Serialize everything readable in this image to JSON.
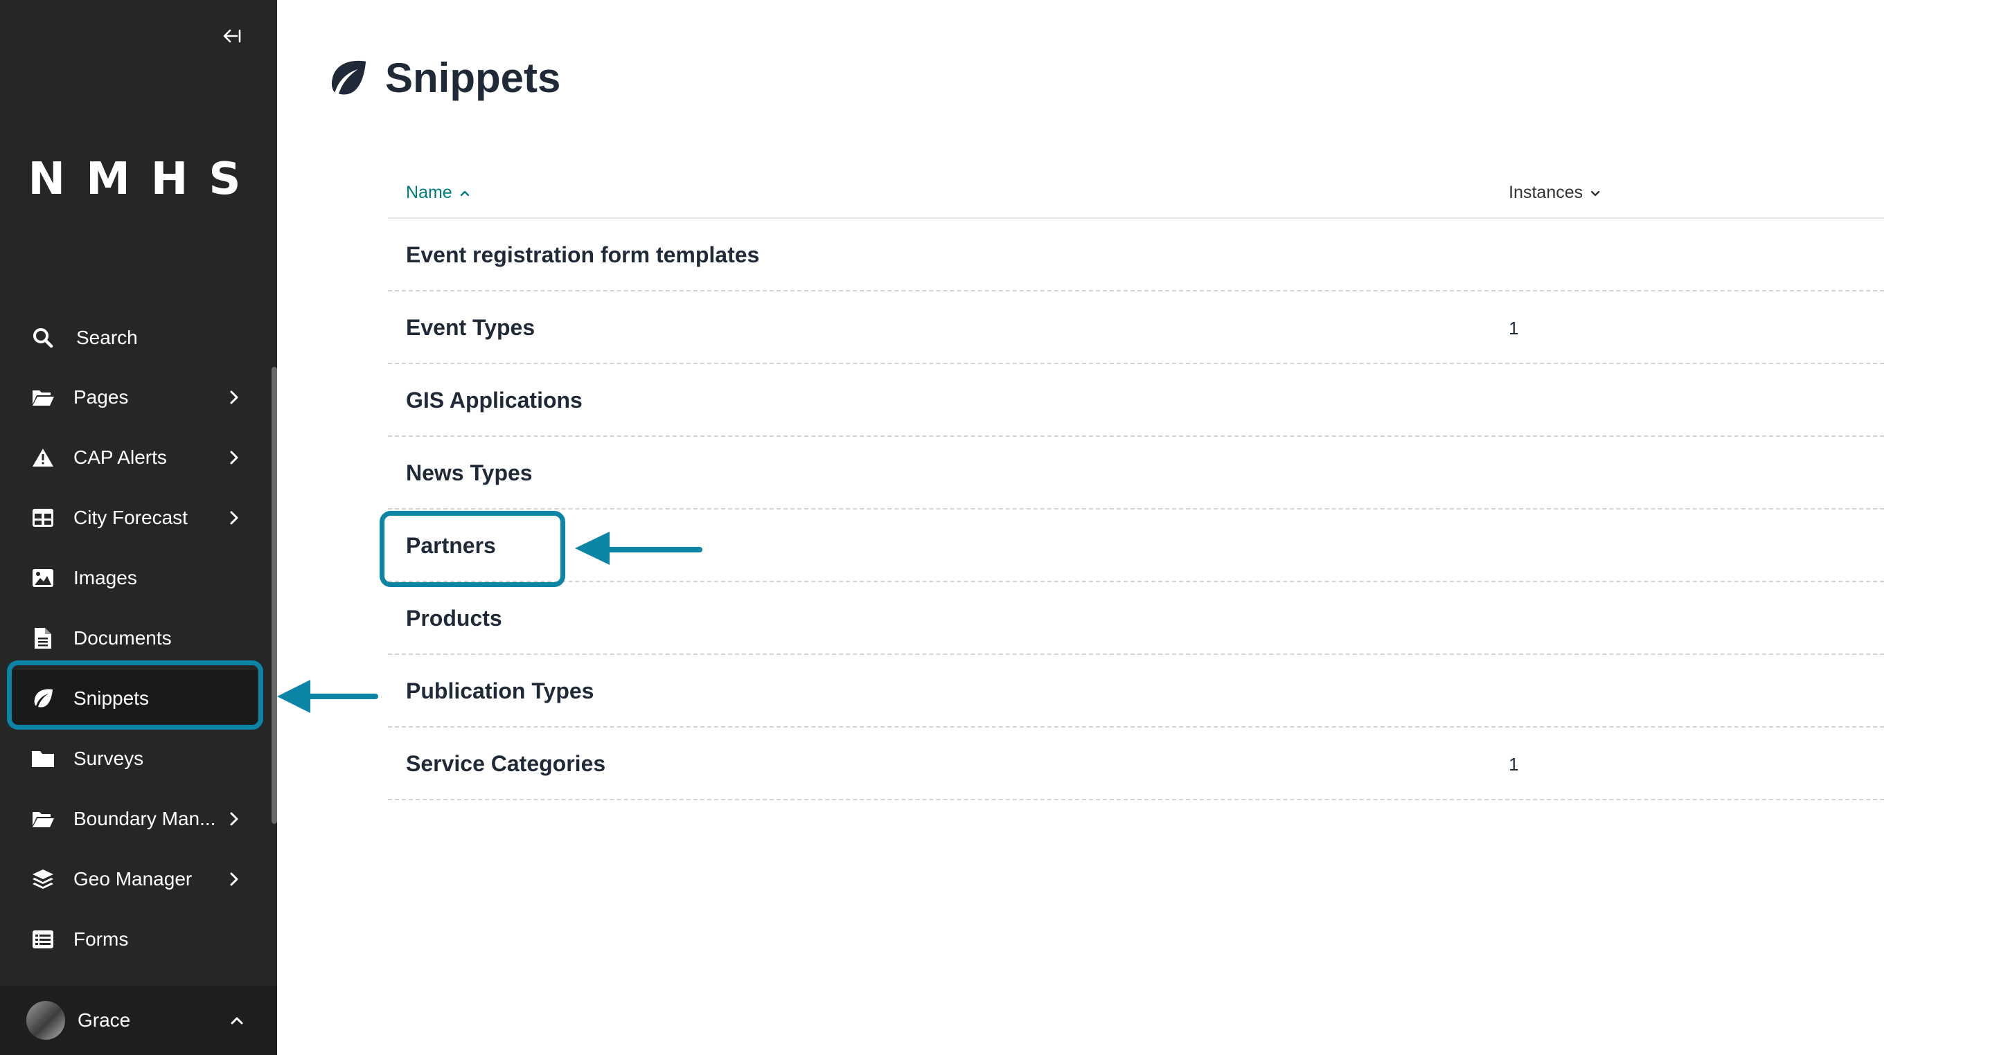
{
  "sidebar": {
    "logo": "NMHS",
    "collapse_icon": "collapse-sidebar-icon",
    "items": [
      {
        "label": "Search",
        "icon": "search-icon",
        "has_submenu": false
      },
      {
        "label": "Pages",
        "icon": "folder-open-icon",
        "has_submenu": true
      },
      {
        "label": "CAP Alerts",
        "icon": "warning-icon",
        "has_submenu": true
      },
      {
        "label": "City Forecast",
        "icon": "table-icon",
        "has_submenu": true
      },
      {
        "label": "Images",
        "icon": "image-icon",
        "has_submenu": false
      },
      {
        "label": "Documents",
        "icon": "document-icon",
        "has_submenu": false
      },
      {
        "label": "Snippets",
        "icon": "leaf-icon",
        "has_submenu": false,
        "active": true
      },
      {
        "label": "Surveys",
        "icon": "folder-icon",
        "has_submenu": false
      },
      {
        "label": "Boundary Man...",
        "icon": "folder-open-icon",
        "has_submenu": true
      },
      {
        "label": "Geo Manager",
        "icon": "layers-icon",
        "has_submenu": true
      },
      {
        "label": "Forms",
        "icon": "list-icon",
        "has_submenu": false
      }
    ],
    "user": {
      "name": "Grace"
    }
  },
  "main": {
    "title": "Snippets",
    "title_icon": "leaf-icon",
    "table": {
      "columns": {
        "name": "Name",
        "instances": "Instances"
      },
      "rows": [
        {
          "name": "Event registration form templates",
          "instances": ""
        },
        {
          "name": "Event Types",
          "instances": "1"
        },
        {
          "name": "GIS Applications",
          "instances": ""
        },
        {
          "name": "News Types",
          "instances": ""
        },
        {
          "name": "Partners",
          "instances": ""
        },
        {
          "name": "Products",
          "instances": ""
        },
        {
          "name": "Publication Types",
          "instances": ""
        },
        {
          "name": "Service Categories",
          "instances": "1"
        }
      ]
    }
  },
  "colors": {
    "sidebar_bg": "#262626",
    "accent": "#0b84a5",
    "link": "#007d7e",
    "text": "#1f2937"
  }
}
